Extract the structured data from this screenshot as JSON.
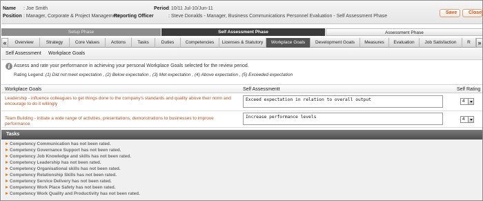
{
  "header": {
    "name_label": "Name",
    "name_value": ": Joe Smith",
    "position_label": "Position",
    "position_value": ": Manager, Corporate & Project Management",
    "period_label": "Period",
    "period_value": ": 10/11 Jul-10/Jun-11",
    "officer_label": "Reporting Officer",
    "officer_value": ": Steve Donalds - Manager, Business Communications  Personnel Evaluation - Self Assessment Phase",
    "save_label": "Save",
    "close_label": "Close"
  },
  "phases": [
    "Setup Phase",
    "Self Assessment Phase",
    "Assessment Phase"
  ],
  "tabs": {
    "left_arrow": "«",
    "right_arrow": "»",
    "items": [
      "Overview",
      "Strategy",
      "Core Values",
      "Actions",
      "Tasks",
      "Duties",
      "Competencies",
      "Licenses & Statutory",
      "Workplace Goals",
      "Development Goals",
      "Measures",
      "Evaluation",
      "Job Satisfaction",
      "R"
    ]
  },
  "breadcrumb": {
    "section": "Self Assessment",
    "page": "Workplace Goals"
  },
  "intro": "Assess and rate your performance in achieving your personal Workplace Goals selected for the review period.",
  "legend": {
    "label": "Rating Legend:",
    "text": "(1) Did not meet expectation , (2) Below expectation , (3) Met expectation , (4) Above expectation , (5) Exceeded expectation"
  },
  "table": {
    "headers": [
      "Workplace Goals",
      "Self Assessmentt",
      "Self Rating"
    ],
    "rows": [
      {
        "goal": "Leadership - influence colleagues to get things done to the company's standards and quality above their norm and encourage to do it willingly",
        "assessment": "Exceed expectation in relation to overall output",
        "rating": "4"
      },
      {
        "goal": "Team Building - initiate a wide range of activities, presentations, demonstrations to businesses to improve performance",
        "assessment": "Increase performance levels",
        "rating": "4"
      }
    ]
  },
  "tasks": {
    "title": "Tasks",
    "items": [
      "Competency Communication has not been rated.",
      "Competency Governance Support has not been rated.",
      "Competency Job Knowledge and skills has not been rated.",
      "Competency Leadership has not been rated.",
      "Competency Organisational skills has not been rated.",
      "Competency Relationship Skills has not been rated.",
      "Competency Service Delivery has not been rated.",
      "Competency Work Place Safety has not been rated.",
      "Competency Work Quality and Productivity has not been rated."
    ]
  },
  "colors": {
    "accent": "#e2541b",
    "active_tab": "#555555",
    "goal_text": "#b0552a",
    "bullet": "#e27a1e"
  }
}
